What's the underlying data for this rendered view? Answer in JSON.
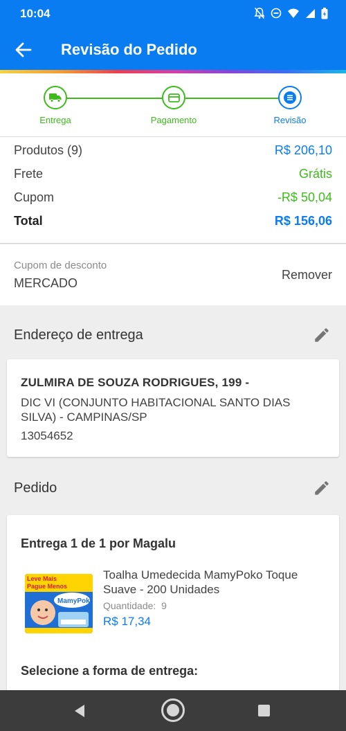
{
  "status": {
    "time": "10:04"
  },
  "header": {
    "title": "Revisão do Pedido"
  },
  "steps": [
    {
      "label": "Entrega",
      "icon": "truck-icon"
    },
    {
      "label": "Pagamento",
      "icon": "card-icon"
    },
    {
      "label": "Revisão",
      "icon": "list-icon"
    }
  ],
  "summary": {
    "products_label": "Produtos (9)",
    "products_value": "R$ 206,10",
    "shipping_label": "Frete",
    "shipping_value": "Grátis",
    "coupon_label": "Cupom",
    "coupon_value": "-R$ 50,04",
    "total_label": "Total",
    "total_value": "R$ 156,06"
  },
  "coupon": {
    "caption": "Cupom de desconto",
    "code": "MERCADO",
    "remove_label": "Remover"
  },
  "address": {
    "section_title": "Endereço de entrega",
    "line1": "ZULMIRA DE SOUZA RODRIGUES, 199 -",
    "line2": "DIC VI (CONJUNTO HABITACIONAL SANTO DIAS SILVA) - CAMPINAS/SP",
    "zip": "13054652"
  },
  "order": {
    "section_title": "Pedido",
    "delivery_title": "Entrega 1 de 1 por Magalu",
    "product_name": "Toalha Umedecida MamyPoko Toque Suave - 200 Unidades",
    "qty_label": "Quantidade:",
    "qty_value": "9",
    "price": "R$ 17,34",
    "image_promo": "Leve Mais Pague Menos",
    "image_brand": "MamyPoko",
    "select_delivery": "Selecione a forma de entrega:"
  },
  "colors": {
    "primary": "#0a7cf2",
    "success": "#3dbb1b",
    "nav": "#3c3c3c"
  }
}
